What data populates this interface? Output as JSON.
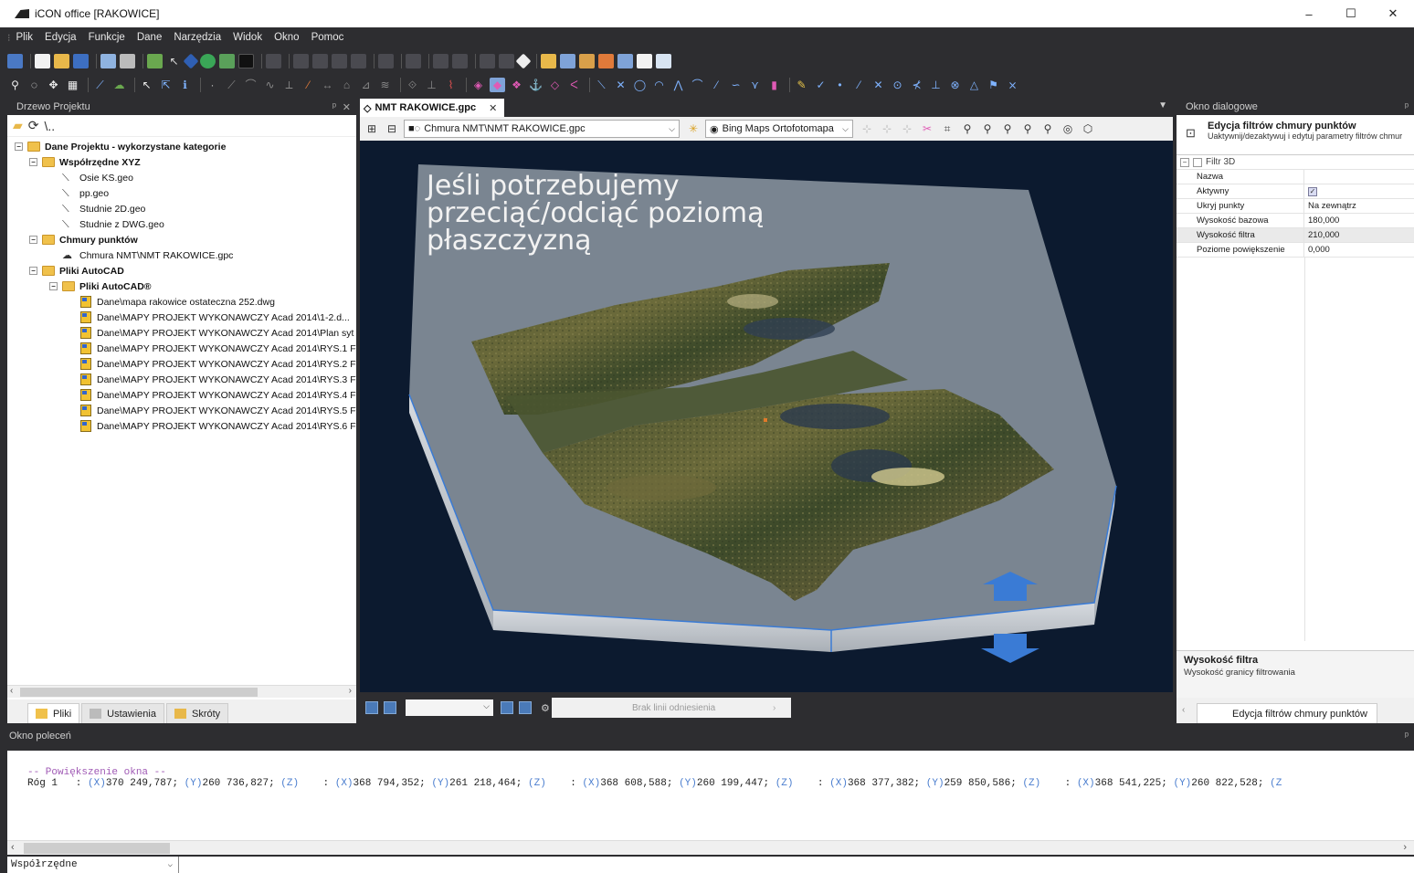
{
  "window": {
    "title": "iCON office [RAKOWICE]",
    "controls": [
      "–",
      "☐",
      "✕"
    ]
  },
  "menu": [
    "Plik",
    "Edycja",
    "Funkcje",
    "Dane",
    "Narzędzia",
    "Widok",
    "Okno",
    "Pomoc"
  ],
  "left_panel": {
    "title": "Drzewo Projektu",
    "pin": "ᵖ",
    "close": "✕",
    "toolbar_path": "\\..",
    "tree": [
      {
        "label": "Dane Projektu - wykorzystane kategorie",
        "level": 0,
        "bold": true,
        "kind": "folder",
        "exp": "−"
      },
      {
        "label": "Współrzędne XYZ",
        "level": 1,
        "bold": true,
        "kind": "folder",
        "exp": "−"
      },
      {
        "label": "Osie KS.geo",
        "level": 2,
        "bold": false,
        "kind": "geo"
      },
      {
        "label": "pp.geo",
        "level": 2,
        "bold": false,
        "kind": "geo"
      },
      {
        "label": "Studnie 2D.geo",
        "level": 2,
        "bold": false,
        "kind": "geo"
      },
      {
        "label": "Studnie z DWG.geo",
        "level": 2,
        "bold": false,
        "kind": "geo"
      },
      {
        "label": "Chmury punktów",
        "level": 1,
        "bold": true,
        "kind": "folder",
        "exp": "−"
      },
      {
        "label": "Chmura NMT\\NMT RAKOWICE.gpc",
        "level": 2,
        "bold": false,
        "kind": "cloud"
      },
      {
        "label": "Pliki AutoCAD",
        "level": 1,
        "bold": true,
        "kind": "folder",
        "exp": "−"
      },
      {
        "label": "Pliki AutoCAD®",
        "level": 2,
        "bold": true,
        "kind": "folder",
        "exp": "−"
      },
      {
        "label": "Dane\\mapa rakowice ostateczna 252.dwg",
        "level": 3,
        "bold": false,
        "kind": "dwg"
      },
      {
        "label": "Dane\\MAPY PROJEKT WYKONAWCZY Acad 2014\\1-2.d...",
        "level": 3,
        "bold": false,
        "kind": "dwg"
      },
      {
        "label": "Dane\\MAPY PROJEKT WYKONAWCZY Acad 2014\\Plan syt",
        "level": 3,
        "bold": false,
        "kind": "dwg"
      },
      {
        "label": "Dane\\MAPY PROJEKT WYKONAWCZY Acad 2014\\RYS.1 F",
        "level": 3,
        "bold": false,
        "kind": "dwg"
      },
      {
        "label": "Dane\\MAPY PROJEKT WYKONAWCZY Acad 2014\\RYS.2 F",
        "level": 3,
        "bold": false,
        "kind": "dwg"
      },
      {
        "label": "Dane\\MAPY PROJEKT WYKONAWCZY Acad 2014\\RYS.3 F",
        "level": 3,
        "bold": false,
        "kind": "dwg"
      },
      {
        "label": "Dane\\MAPY PROJEKT WYKONAWCZY Acad 2014\\RYS.4 F",
        "level": 3,
        "bold": false,
        "kind": "dwg"
      },
      {
        "label": "Dane\\MAPY PROJEKT WYKONAWCZY Acad 2014\\RYS.5 F",
        "level": 3,
        "bold": false,
        "kind": "dwg"
      },
      {
        "label": "Dane\\MAPY PROJEKT WYKONAWCZY Acad 2014\\RYS.6 F",
        "level": 3,
        "bold": false,
        "kind": "dwg"
      }
    ],
    "tabs": [
      {
        "label": "Pliki",
        "active": true
      },
      {
        "label": "Ustawienia",
        "active": false
      },
      {
        "label": "Skróty",
        "active": false
      }
    ]
  },
  "document": {
    "tab_label": "NMT RAKOWICE.gpc",
    "tab_close": "✕",
    "layer_combo": "Chmura NMT\\NMT RAKOWICE.gpc",
    "basemap_combo": "Bing Maps Ortofotomapa",
    "overlay_text": "Jeśli potrzebujemy przeciąć/odciąć poziomą płaszczyzną",
    "reference_label": "Brak linii odniesienia"
  },
  "right_panel": {
    "title": "Okno dialogowe",
    "pin": "ᵖ",
    "header_title": "Edycja filtrów chmury punktów",
    "header_subtitle": "Uaktywnij/dezaktywuj i edytuj parametry filtrów chmur",
    "category": "Filtr 3D",
    "properties": [
      {
        "key": "Nazwa",
        "value": ""
      },
      {
        "key": "Aktywny",
        "value": "✓",
        "checkbox": true
      },
      {
        "key": "Ukryj punkty",
        "value": "Na zewnątrz"
      },
      {
        "key": "Wysokość bazowa",
        "value": "180,000"
      },
      {
        "key": "Wysokość filtra",
        "value": "210,000",
        "highlight": true
      },
      {
        "key": "Poziome powiększenie",
        "value": "0,000"
      }
    ],
    "description_title": "Wysokość filtra",
    "description_text": "Wysokość granicy filtrowania",
    "tab_label": "Edycja filtrów chmury punktów"
  },
  "command": {
    "title": "Okno poleceń",
    "pin": "ᵖ",
    "line1": "-- Powiększenie okna --",
    "line2": [
      {
        "t": "Róg 1   : ",
        "c": "n"
      },
      {
        "t": "(X)",
        "c": "a"
      },
      {
        "t": "370 249,787; ",
        "c": "n"
      },
      {
        "t": "(Y)",
        "c": "a"
      },
      {
        "t": "260 736,827; ",
        "c": "n"
      },
      {
        "t": "(Z)",
        "c": "a"
      },
      {
        "t": "    : ",
        "c": "n"
      },
      {
        "t": "(X)",
        "c": "a"
      },
      {
        "t": "368 794,352; ",
        "c": "n"
      },
      {
        "t": "(Y)",
        "c": "a"
      },
      {
        "t": "261 218,464; ",
        "c": "n"
      },
      {
        "t": "(Z)",
        "c": "a"
      },
      {
        "t": "    : ",
        "c": "n"
      },
      {
        "t": "(X)",
        "c": "a"
      },
      {
        "t": "368 608,588; ",
        "c": "n"
      },
      {
        "t": "(Y)",
        "c": "a"
      },
      {
        "t": "260 199,447; ",
        "c": "n"
      },
      {
        "t": "(Z)",
        "c": "a"
      },
      {
        "t": "    : ",
        "c": "n"
      },
      {
        "t": "(X)",
        "c": "a"
      },
      {
        "t": "368 377,382; ",
        "c": "n"
      },
      {
        "t": "(Y)",
        "c": "a"
      },
      {
        "t": "259 850,586; ",
        "c": "n"
      },
      {
        "t": "(Z)",
        "c": "a"
      },
      {
        "t": "    : ",
        "c": "n"
      },
      {
        "t": "(X)",
        "c": "a"
      },
      {
        "t": "368 541,225; ",
        "c": "n"
      },
      {
        "t": "(Y)",
        "c": "a"
      },
      {
        "t": "260 822,528; ",
        "c": "n"
      },
      {
        "t": "(Z",
        "c": "a"
      }
    ],
    "input_mode": "Współrzędne"
  },
  "colors": {
    "chrome": "#2d2d30",
    "accent_blue": "#3a7bd5",
    "plane": "#7a8591",
    "viewport_bg": "#0c1a2f"
  }
}
